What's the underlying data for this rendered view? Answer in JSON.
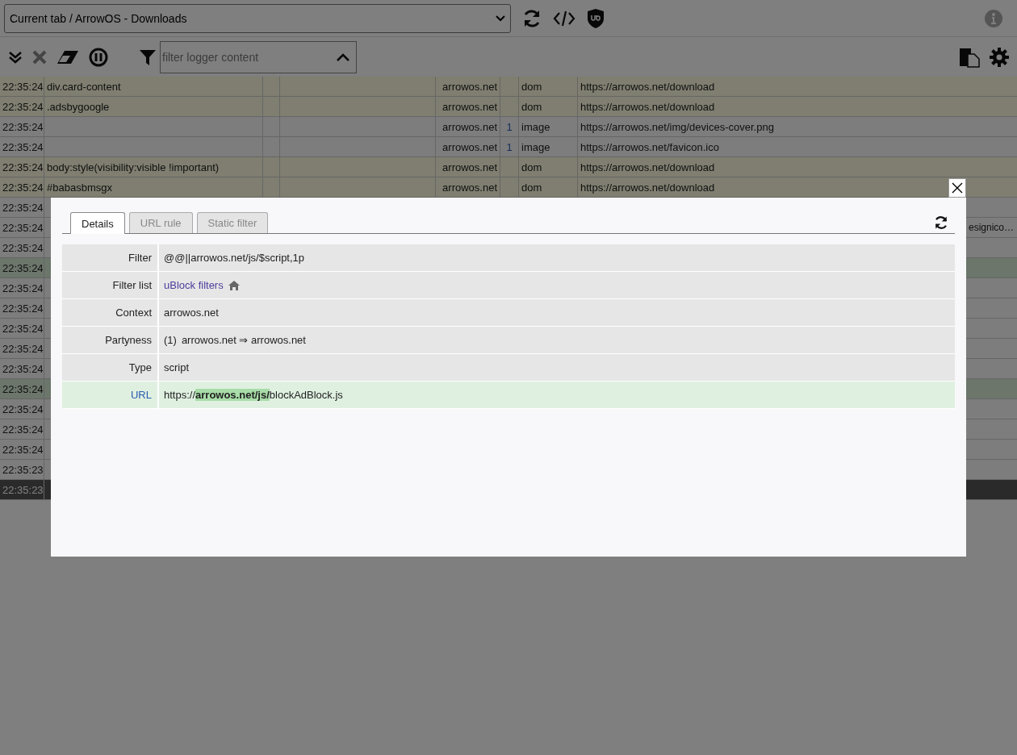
{
  "toolbar": {
    "tab_select": "Current tab / ArrowOS - Downloads",
    "filter_placeholder": "filter logger content"
  },
  "log_rows": [
    {
      "time": "22:35:24",
      "filter": "div.card-content",
      "domain": "arrowos.net",
      "count": "",
      "type": "dom",
      "url": "https://arrowos.net/download",
      "kind": "dom",
      "selected": false
    },
    {
      "time": "22:35:24",
      "filter": ".adsbygoogle",
      "domain": "arrowos.net",
      "count": "",
      "type": "dom",
      "url": "https://arrowos.net/download",
      "kind": "dom",
      "selected": false
    },
    {
      "time": "22:35:24",
      "filter": "",
      "domain": "arrowos.net",
      "count": "1",
      "type": "image",
      "url": "https://arrowos.net/img/devices-cover.png",
      "kind": "network",
      "selected": false
    },
    {
      "time": "22:35:24",
      "filter": "",
      "domain": "arrowos.net",
      "count": "1",
      "type": "image",
      "url": "https://arrowos.net/favicon.ico",
      "kind": "network",
      "selected": false
    },
    {
      "time": "22:35:24",
      "filter": "body:style(visibility:visible !important)",
      "domain": "arrowos.net",
      "count": "",
      "type": "dom",
      "url": "https://arrowos.net/download",
      "kind": "dom",
      "selected": false
    },
    {
      "time": "22:35:24",
      "filter": "#babasbmsgx",
      "domain": "arrowos.net",
      "count": "",
      "type": "dom",
      "url": "https://arrowos.net/download",
      "kind": "dom",
      "selected": false
    },
    {
      "time": "22:35:24",
      "kind": "network",
      "selected": false
    },
    {
      "time": "22:35:24",
      "url_tail": "esignico…",
      "kind": "network",
      "selected": false
    },
    {
      "time": "22:35:24",
      "kind": "network",
      "selected": false
    },
    {
      "time": "22:35:24",
      "kind": "allowed",
      "selected": false
    },
    {
      "time": "22:35:24",
      "kind": "network",
      "selected": false
    },
    {
      "time": "22:35:24",
      "kind": "network",
      "selected": false
    },
    {
      "time": "22:35:24",
      "kind": "network",
      "selected": false
    },
    {
      "time": "22:35:24",
      "kind": "network",
      "selected": false
    },
    {
      "time": "22:35:24",
      "kind": "network",
      "selected": false
    },
    {
      "time": "22:35:24",
      "kind": "allowed",
      "selected": false
    },
    {
      "time": "22:35:24",
      "kind": "network",
      "selected": false
    },
    {
      "time": "22:35:24",
      "kind": "network",
      "selected": false
    },
    {
      "time": "22:35:24",
      "kind": "network",
      "selected": false
    },
    {
      "time": "22:35:23",
      "kind": "network",
      "selected": false
    },
    {
      "time": "22:35:23",
      "kind": "network",
      "selected": true
    }
  ],
  "dialog": {
    "tabs": [
      {
        "label": "Details",
        "selected": true
      },
      {
        "label": "URL rule",
        "selected": false
      },
      {
        "label": "Static filter",
        "selected": false
      }
    ],
    "details": [
      {
        "label": "Filter",
        "value": "@@||arrowos.net/js/$script,1p",
        "kind": "text"
      },
      {
        "label": "Filter list",
        "value": "uBlock filters",
        "kind": "link"
      },
      {
        "label": "Context",
        "value": "arrowos.net",
        "kind": "text"
      },
      {
        "label": "Partyness",
        "party": "(1)",
        "value": "arrowos.net ⇒ arrowos.net",
        "kind": "party"
      },
      {
        "label": "Type",
        "value": "script",
        "kind": "text"
      },
      {
        "label": "URL",
        "value": "https://**arrowos.net/js/**blockAdBlock.js",
        "kind": "url"
      }
    ]
  }
}
